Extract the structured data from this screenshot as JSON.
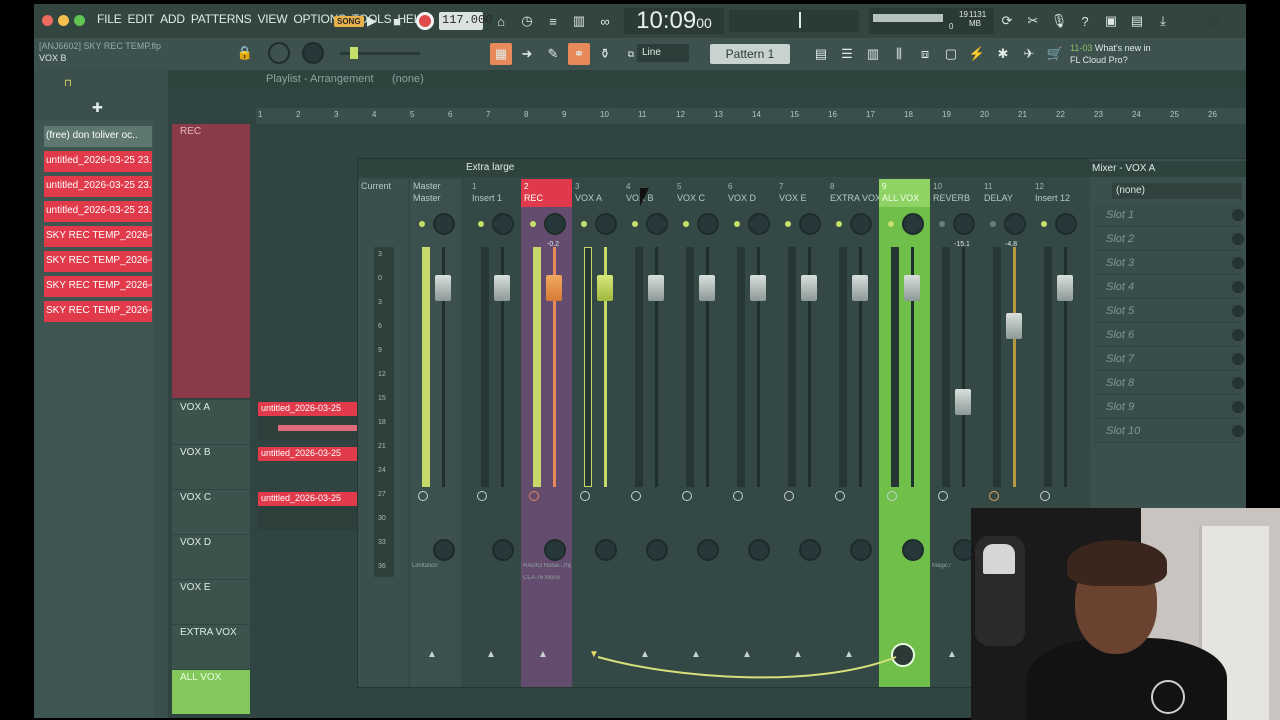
{
  "menu": [
    "FILE",
    "EDIT",
    "ADD",
    "PATTERNS",
    "VIEW",
    "OPTIONS",
    "TOOLS",
    "HELP"
  ],
  "transport": {
    "mode": "SONG",
    "tempo": "117.000",
    "time_main": "10:09",
    "time_sub": "00",
    "time_unit": "B:S:T"
  },
  "cpu": {
    "value": "19",
    "memory": "1131 MB",
    "zero": "0"
  },
  "hint": {
    "line1": "[ANJ6602] SKY REC TEMP.flp",
    "line2": "VOX B"
  },
  "snap": {
    "label": "Line"
  },
  "pattern": {
    "label": "Pattern 1"
  },
  "news": {
    "date": "11-03",
    "text": "What's new in",
    "text2": "FL Cloud Pro?"
  },
  "browser": {
    "items": [
      "(free) don toliver  oc..",
      "untitled_2026-03-25 23..",
      "untitled_2026-03-25 23..",
      "untitled_2026-03-25 23..",
      "SKY REC TEMP_2026-03-..",
      "SKY REC TEMP_2026-03-..",
      "SKY REC TEMP_2026-03-..",
      "SKY REC TEMP_2026-03-.."
    ]
  },
  "playlist": {
    "title": "Playlist - Arrangement",
    "pattern": "(none)",
    "ruler": [
      "1",
      "2",
      "3",
      "4",
      "5",
      "6",
      "7",
      "8",
      "9",
      "10",
      "11",
      "12",
      "13",
      "14",
      "15",
      "16",
      "17",
      "18",
      "19",
      "20",
      "21",
      "22",
      "23",
      "24",
      "25",
      "26"
    ],
    "rec_label": "REC",
    "tracks": [
      "VOX A",
      "VOX B",
      "VOX C",
      "VOX D",
      "VOX E",
      "EXTRA VOX",
      "ALL VOX"
    ],
    "clips": [
      "untitled_2026-03-25",
      "untitled_2026-03-25",
      "untitled_2026-03-25"
    ]
  },
  "mixer": {
    "title": "Mixer - VOX A",
    "size": "Extra large",
    "current": "Current",
    "scale": [
      "3",
      "0",
      "3",
      "6",
      "9",
      "12",
      "15",
      "18",
      "21",
      "24",
      "27",
      "30",
      "33",
      "36"
    ],
    "strips": [
      {
        "num": "",
        "name": "Master",
        "sub": "Master"
      },
      {
        "num": "1",
        "name": "Insert 1",
        "sub": ""
      },
      {
        "num": "2",
        "name": "REC",
        "sub": "-0.2"
      },
      {
        "num": "3",
        "name": "VOX A",
        "sub": ""
      },
      {
        "num": "4",
        "name": "VOX B",
        "sub": ""
      },
      {
        "num": "5",
        "name": "VOX C",
        "sub": ""
      },
      {
        "num": "6",
        "name": "VOX D",
        "sub": ""
      },
      {
        "num": "7",
        "name": "VOX E",
        "sub": ""
      },
      {
        "num": "8",
        "name": "EXTRA VOX",
        "sub": ""
      },
      {
        "num": "9",
        "name": "ALL VOX",
        "sub": ""
      },
      {
        "num": "10",
        "name": "REVERB",
        "sub": "-15.1"
      },
      {
        "num": "11",
        "name": "DELAY",
        "sub": "-4.8"
      },
      {
        "num": "12",
        "name": "Insert 12",
        "sub": ""
      }
    ],
    "strip_notes": {
      "master": "Limitation",
      "rec": "RADIO Noise...mp and EQ",
      "rec2": "CLA-76 Mono",
      "reverb": "Magic7"
    },
    "fx_select": "(none)",
    "slots": [
      "Slot 1",
      "Slot 2",
      "Slot 3",
      "Slot 4",
      "Slot 5",
      "Slot 6",
      "Slot 7",
      "Slot 8",
      "Slot 9",
      "Slot 10"
    ]
  },
  "colors": {
    "accent_red": "#e0394b",
    "accent_green": "#82c85b",
    "bg": "#3a4e4b"
  }
}
